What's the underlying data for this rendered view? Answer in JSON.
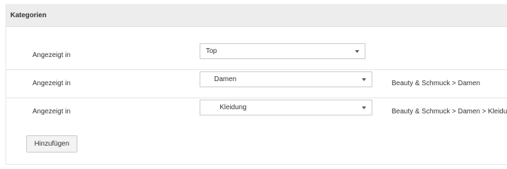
{
  "panel": {
    "title": "Kategorien"
  },
  "rows": [
    {
      "label": "Angezeigt in",
      "selected": "Top",
      "path": ""
    },
    {
      "label": "Angezeigt in",
      "selected": "Damen",
      "path": "Beauty & Schmuck > Damen"
    },
    {
      "label": "Angezeigt in",
      "selected": "Kleidung",
      "path": "Beauty & Schmuck > Damen > Kleidung"
    }
  ],
  "actions": {
    "add_label": "Hinzufügen"
  },
  "icons": {
    "dropdown": "chevron-down-icon"
  }
}
